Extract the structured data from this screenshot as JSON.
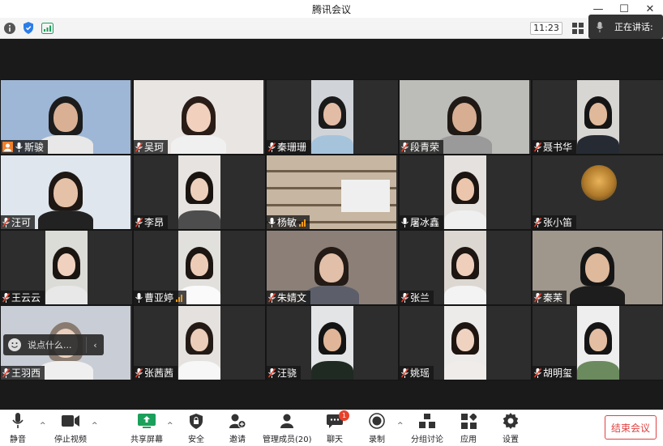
{
  "window": {
    "title": "腾讯会议",
    "controls": {
      "minimize": "—",
      "maximize": "☐",
      "close": "✕"
    }
  },
  "infobar": {
    "time": "11:23",
    "speaking_label": "正在讲话:",
    "icons": [
      "info-icon",
      "shield-icon",
      "signal-icon",
      "grid-view-icon"
    ]
  },
  "participants": [
    {
      "name": "斯骏",
      "muted": false,
      "host": true
    },
    {
      "name": "吴珂",
      "muted": true
    },
    {
      "name": "秦珊珊",
      "muted": true
    },
    {
      "name": "段青荣",
      "muted": true
    },
    {
      "name": "聂书华",
      "muted": true
    },
    {
      "name": "汪可",
      "muted": true
    },
    {
      "name": "李昂",
      "muted": true
    },
    {
      "name": "杨敏",
      "muted": false,
      "speaking": true
    },
    {
      "name": "屠冰鑫",
      "muted": false
    },
    {
      "name": "张小笛",
      "muted": true
    },
    {
      "name": "王云云",
      "muted": true
    },
    {
      "name": "曹亚婷",
      "muted": false,
      "speaking": true
    },
    {
      "name": "朱婧文",
      "muted": true
    },
    {
      "name": "张兰",
      "muted": true
    },
    {
      "name": "秦苿",
      "muted": true
    },
    {
      "name": "王羽西",
      "muted": true
    },
    {
      "name": "张茜茜",
      "muted": true
    },
    {
      "name": "汪骁",
      "muted": true
    },
    {
      "name": "姚瑶",
      "muted": true
    },
    {
      "name": "胡明玺",
      "muted": true
    }
  ],
  "chat_popup": {
    "placeholder": "说点什么..."
  },
  "toolbar": {
    "mute": "静音",
    "stop_video": "停止视频",
    "share_screen": "共享屏幕",
    "security": "安全",
    "invite": "邀请",
    "members": "管理成员(20)",
    "chat": "聊天",
    "chat_badge": "1",
    "record": "录制",
    "breakout": "分组讨论",
    "apps": "应用",
    "settings": "设置",
    "end_meeting": "结束会议"
  },
  "colors": {
    "end_button": "#e04141",
    "share_icon": "#1aa05a",
    "badge": "#e8412b",
    "speaking_level": "#f39a1a"
  }
}
